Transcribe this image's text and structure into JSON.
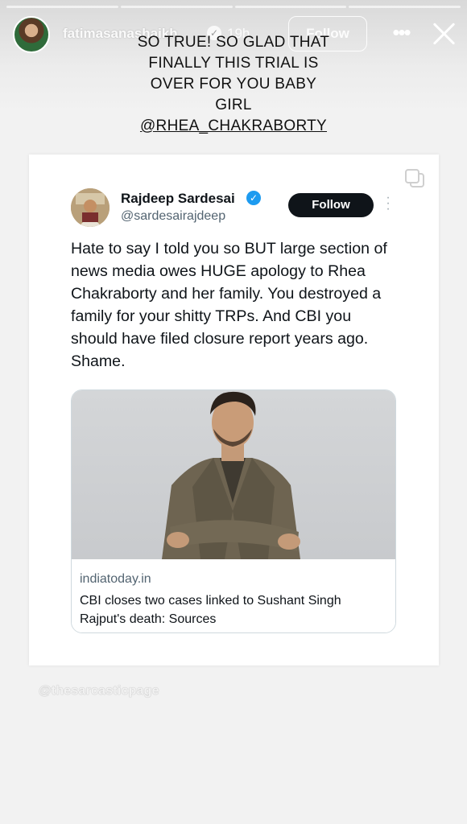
{
  "story": {
    "progress_segments": 4,
    "username": "fatimasanashaikh",
    "time": "19h",
    "follow_label": "Follow",
    "caption_lines": [
      "SO TRUE!  SO GLAD THAT",
      "FINALLY THIS TRIAL IS",
      "OVER FOR YOU BABY",
      "GIRL"
    ],
    "mention": "@RHEA_CHAKRABORTY",
    "watermark": "@thesarcasticpage"
  },
  "tweet": {
    "name": "Rajdeep Sardesai",
    "handle": "@sardesairajdeep",
    "follow_label": "Follow",
    "text": "Hate to say I told you so BUT large section of news media owes HUGE apology to Rhea Chakraborty and her family. You destroyed a family for your shitty TRPs. And CBI you should have filed closure report years ago. Shame.",
    "link": {
      "domain": "indiatoday.in",
      "title": "CBI closes two cases linked to Sushant Singh Rajput's death: Sources"
    }
  },
  "icons": {
    "verified": "verified-badge-icon",
    "more": "more-icon",
    "close": "close-icon",
    "copy": "copy-icon"
  },
  "colors": {
    "twitter_blue": "#1d9bf0",
    "tweet_text": "#0f1419",
    "tweet_secondary": "#536471"
  }
}
